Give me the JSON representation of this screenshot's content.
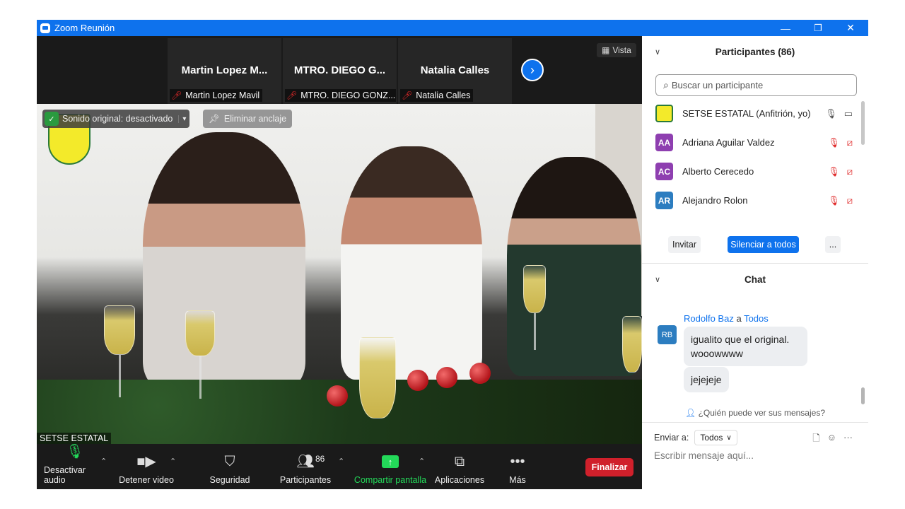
{
  "window": {
    "title": "Zoom Reunión",
    "controls": {
      "minimize": "—",
      "restore": "❐",
      "close": "✕"
    }
  },
  "strip": {
    "tiles": [
      {
        "big_name": "Martin Lopez M...",
        "label": "Martin Lopez Mavil"
      },
      {
        "big_name": "MTRO. DIEGO G...",
        "label": "MTRO. DIEGO GONZ..."
      },
      {
        "big_name": "Natalia Calles",
        "label": "Natalia Calles"
      }
    ],
    "next_icon": "chevron-right-icon",
    "view_label": "Vista"
  },
  "video": {
    "sound_label": "Sonido original: desactivado",
    "unpin_label": "Eliminar anclaje",
    "speaker": "SETSE ESTATAL"
  },
  "toolbar": {
    "audio_label": "Desactivar audio",
    "video_label": "Detener video",
    "security_label": "Seguridad",
    "participants_label": "Participantes",
    "participants_count": "86",
    "share_label": "Compartir pantalla",
    "apps_label": "Aplicaciones",
    "more_label": "Más",
    "end_label": "Finalizar"
  },
  "participants": {
    "header": "Participantes (86)",
    "search_placeholder": "Buscar un participante",
    "items": [
      {
        "initials": "",
        "name": "SETSE ESTATAL (Anfitrión, yo)",
        "color": "#f3ea2a",
        "muted": false
      },
      {
        "initials": "AA",
        "name": "Adriana Aguilar Valdez",
        "color": "#8e3fb0",
        "muted": true
      },
      {
        "initials": "AC",
        "name": "Alberto Cerecedo",
        "color": "#8e3fb0",
        "muted": true
      },
      {
        "initials": "AR",
        "name": "Alejandro Rolon",
        "color": "#2c7dc0",
        "muted": true
      }
    ],
    "invite_label": "Invitar",
    "mute_all_label": "Silenciar a todos",
    "more_label": "..."
  },
  "chat": {
    "header": "Chat",
    "from": "Rodolfo Baz",
    "to_word": "a",
    "to": "Todos",
    "avatar": "RB",
    "messages": [
      "igualito que el original. wooowwww",
      "jejejeje"
    ],
    "who_sees": "¿Quién puede ver sus mensajes?",
    "send_to_label": "Enviar a:",
    "send_to_value": "Todos",
    "input_placeholder": "Escribir mensaje aquí..."
  }
}
